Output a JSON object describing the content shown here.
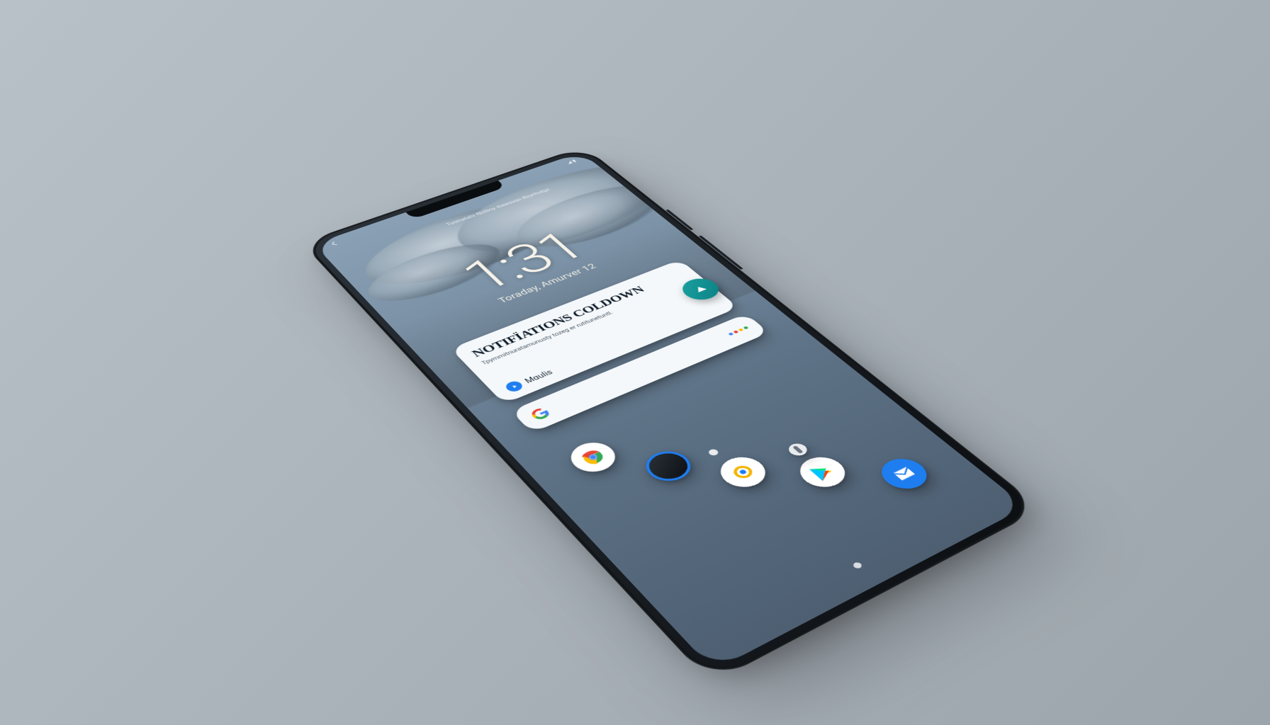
{
  "status": {
    "back_icon": "back-icon",
    "right_text": "◢ ▮"
  },
  "topline": "Tươnətahi Nolliny itweovɑn Royrhutgɛ",
  "clock": {
    "time": "1:31",
    "date": "Toraday, Amurver 12"
  },
  "notification": {
    "title": "Notifïations Coldown",
    "subtitle": "Tpymmitnuratamunusty tozeg er rutitunetuntl.",
    "footer_label": "Mɑulis",
    "action_icon": "play-up-icon"
  },
  "search": {
    "provider": "google",
    "placeholder": ""
  },
  "dock": {
    "items": [
      {
        "name": "chrome"
      },
      {
        "name": "phone"
      },
      {
        "name": "ring"
      },
      {
        "name": "play-store"
      },
      {
        "name": "mail"
      }
    ]
  }
}
